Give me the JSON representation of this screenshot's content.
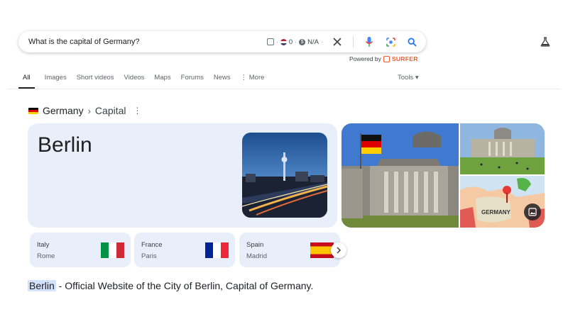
{
  "search": {
    "query": "What is the capital of Germany?",
    "ext_count": "0",
    "ext_value": "N/A"
  },
  "powered_by": {
    "label": "Powered by",
    "brand": "SURFER"
  },
  "tabs": [
    {
      "label": "All",
      "active": true
    },
    {
      "label": "Images",
      "active": false
    },
    {
      "label": "Short videos",
      "active": false
    },
    {
      "label": "Videos",
      "active": false
    },
    {
      "label": "Maps",
      "active": false
    },
    {
      "label": "Forums",
      "active": false
    },
    {
      "label": "News",
      "active": false
    },
    {
      "label": "⋮ More",
      "active": false
    }
  ],
  "tools_label": "Tools ▾",
  "breadcrumb": {
    "country": "Germany",
    "separator": "›",
    "topic": "Capital"
  },
  "answer": {
    "city": "Berlin"
  },
  "related": [
    {
      "country": "Italy",
      "capital": "Rome"
    },
    {
      "country": "France",
      "capital": "Paris"
    },
    {
      "country": "Spain",
      "capital": "Madrid"
    }
  ],
  "snippet": {
    "highlight": "Berlin",
    "text": " - Official Website of the City of Berlin, Capital of Germany."
  },
  "colors": {
    "accent_blue": "#1a73e8",
    "card_bg": "#e8eefa",
    "surfer_orange": "#f25a2c"
  }
}
